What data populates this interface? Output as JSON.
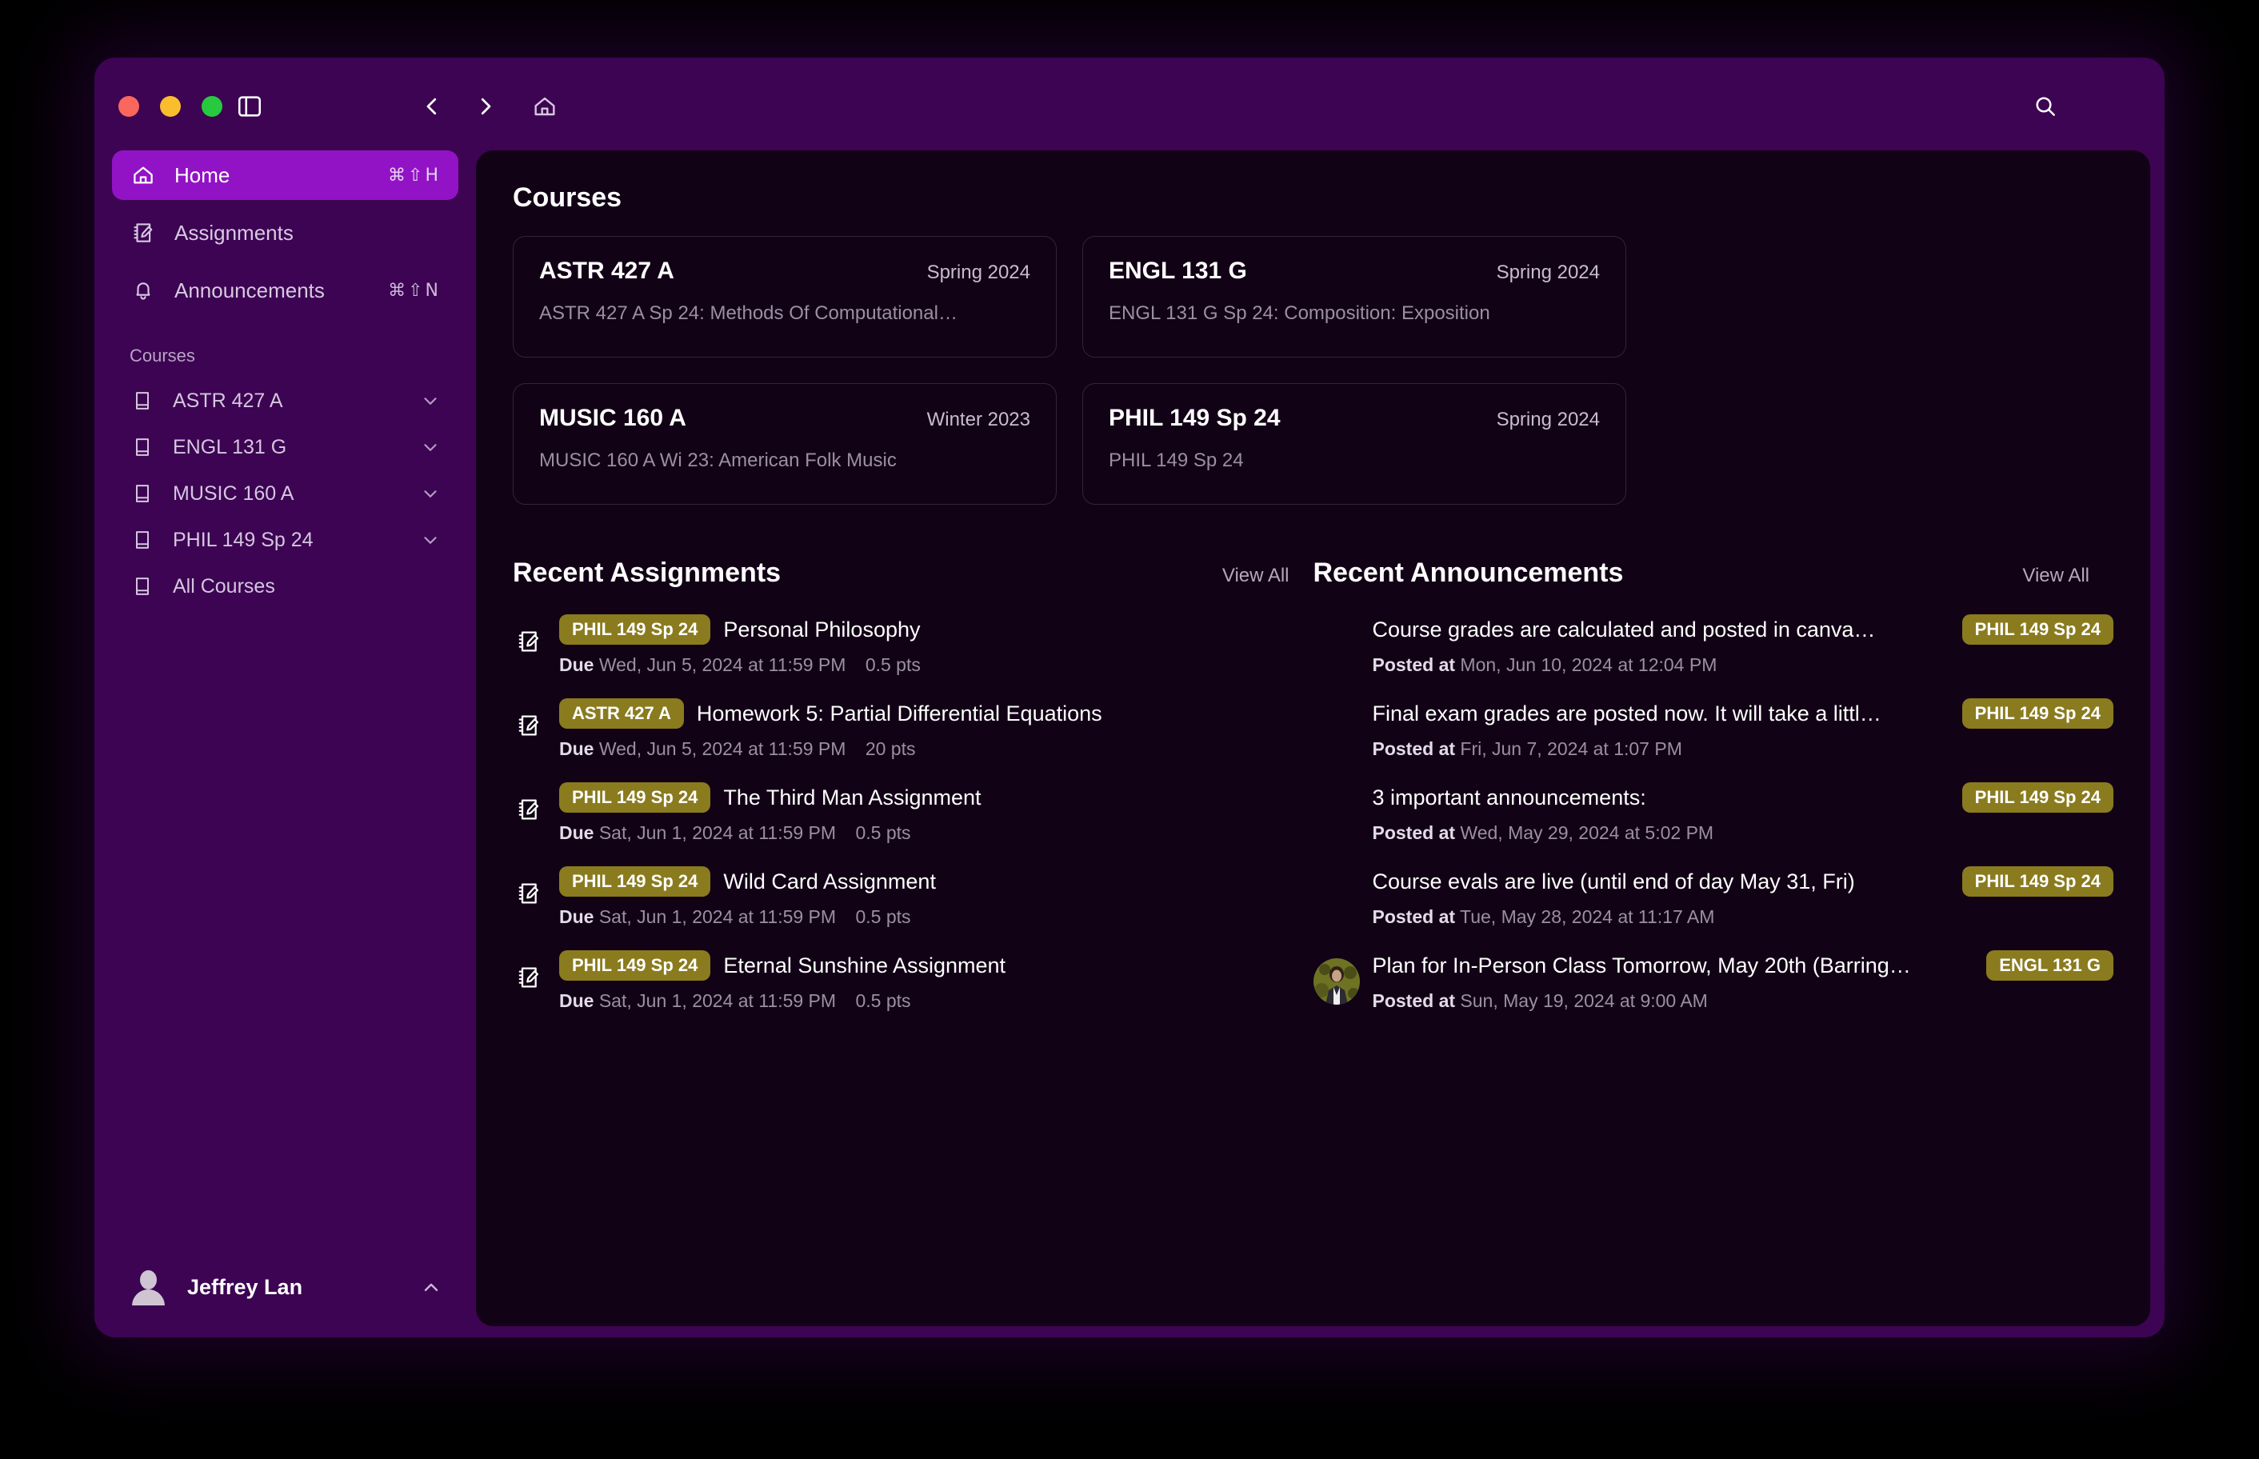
{
  "window": {
    "traffic_lights": [
      "close",
      "minimize",
      "zoom"
    ],
    "toolbar_icons": [
      "sidebar-toggle-icon",
      "back-icon",
      "forward-icon",
      "home-icon",
      "search-icon"
    ]
  },
  "sidebar": {
    "nav": [
      {
        "label": "Home",
        "icon": "home-icon",
        "shortcut": "⌘⇧H",
        "active": true
      },
      {
        "label": "Assignments",
        "icon": "assignments-icon",
        "shortcut": "",
        "active": false
      },
      {
        "label": "Announcements",
        "icon": "bell-icon",
        "shortcut": "⌘⇧N",
        "active": false
      }
    ],
    "section_label": "Courses",
    "courses": [
      {
        "label": "ASTR 427 A",
        "icon": "book-icon",
        "expandable": true
      },
      {
        "label": "ENGL 131 G",
        "icon": "book-icon",
        "expandable": true
      },
      {
        "label": "MUSIC 160 A",
        "icon": "book-icon",
        "expandable": true
      },
      {
        "label": "PHIL 149 Sp 24",
        "icon": "book-icon",
        "expandable": true
      },
      {
        "label": "All Courses",
        "icon": "book-icon",
        "expandable": false
      }
    ],
    "user": {
      "name": "Jeffrey Lan",
      "avatar": "user-avatar",
      "chevron": "chevron-up-icon"
    }
  },
  "main": {
    "courses_heading": "Courses",
    "course_cards": [
      {
        "code": "ASTR 427 A",
        "term": "Spring 2024",
        "desc": "ASTR 427 A Sp 24: Methods Of Computational…"
      },
      {
        "code": "ENGL 131 G",
        "term": "Spring 2024",
        "desc": "ENGL 131 G Sp 24: Composition: Exposition"
      },
      {
        "code": "MUSIC 160 A",
        "term": "Winter 2023",
        "desc": "MUSIC 160 A Wi 23: American Folk Music"
      },
      {
        "code": "PHIL 149 Sp 24",
        "term": "Spring 2024",
        "desc": "PHIL 149 Sp 24"
      }
    ],
    "assignments": {
      "heading": "Recent Assignments",
      "view_all": "View All",
      "due_label": "Due",
      "items": [
        {
          "badge": "PHIL 149 Sp 24",
          "title": "Personal Philosophy",
          "due": "Wed, Jun 5, 2024 at 11:59 PM",
          "points": "0.5 pts"
        },
        {
          "badge": "ASTR 427 A",
          "title": "Homework 5: Partial Differential Equations",
          "due": "Wed, Jun 5, 2024 at 11:59 PM",
          "points": "20 pts"
        },
        {
          "badge": "PHIL 149 Sp 24",
          "title": "The Third Man Assignment",
          "due": "Sat, Jun 1, 2024 at 11:59 PM",
          "points": "0.5 pts"
        },
        {
          "badge": "PHIL 149 Sp 24",
          "title": "Wild Card Assignment",
          "due": "Sat, Jun 1, 2024 at 11:59 PM",
          "points": "0.5 pts"
        },
        {
          "badge": "PHIL 149 Sp 24",
          "title": "Eternal Sunshine Assignment",
          "due": "Sat, Jun 1, 2024 at 11:59 PM",
          "points": "0.5 pts"
        }
      ]
    },
    "announcements": {
      "heading": "Recent Announcements",
      "view_all": "View All",
      "posted_label": "Posted at",
      "items": [
        {
          "title": "Course grades are calculated and posted in canva…",
          "posted": "Mon, Jun 10, 2024 at 12:04 PM",
          "badge": "PHIL 149 Sp 24",
          "has_avatar": false
        },
        {
          "title": "Final exam grades are posted now. It will take a littl…",
          "posted": "Fri, Jun 7, 2024 at 1:07 PM",
          "badge": "PHIL 149 Sp 24",
          "has_avatar": false
        },
        {
          "title": "3 important announcements:",
          "posted": "Wed, May 29, 2024 at 5:02 PM",
          "badge": "PHIL 149 Sp 24",
          "has_avatar": false
        },
        {
          "title": "Course evals are live (until end of day May 31, Fri)",
          "posted": "Tue, May 28, 2024 at 11:17 AM",
          "badge": "PHIL 149 Sp 24",
          "has_avatar": false
        },
        {
          "title": "Plan for In-Person Class Tomorrow, May 20th (Barring…",
          "posted": "Sun, May 19, 2024 at 9:00 AM",
          "badge": "ENGL 131 G",
          "has_avatar": true
        }
      ]
    }
  },
  "colors": {
    "window_chrome": "#3c0452",
    "content_bg": "#120216",
    "accent_active": "#9213c6",
    "badge": "#8a7b1f",
    "text_primary": "#ffffff",
    "text_muted": "#9b8fa4"
  }
}
